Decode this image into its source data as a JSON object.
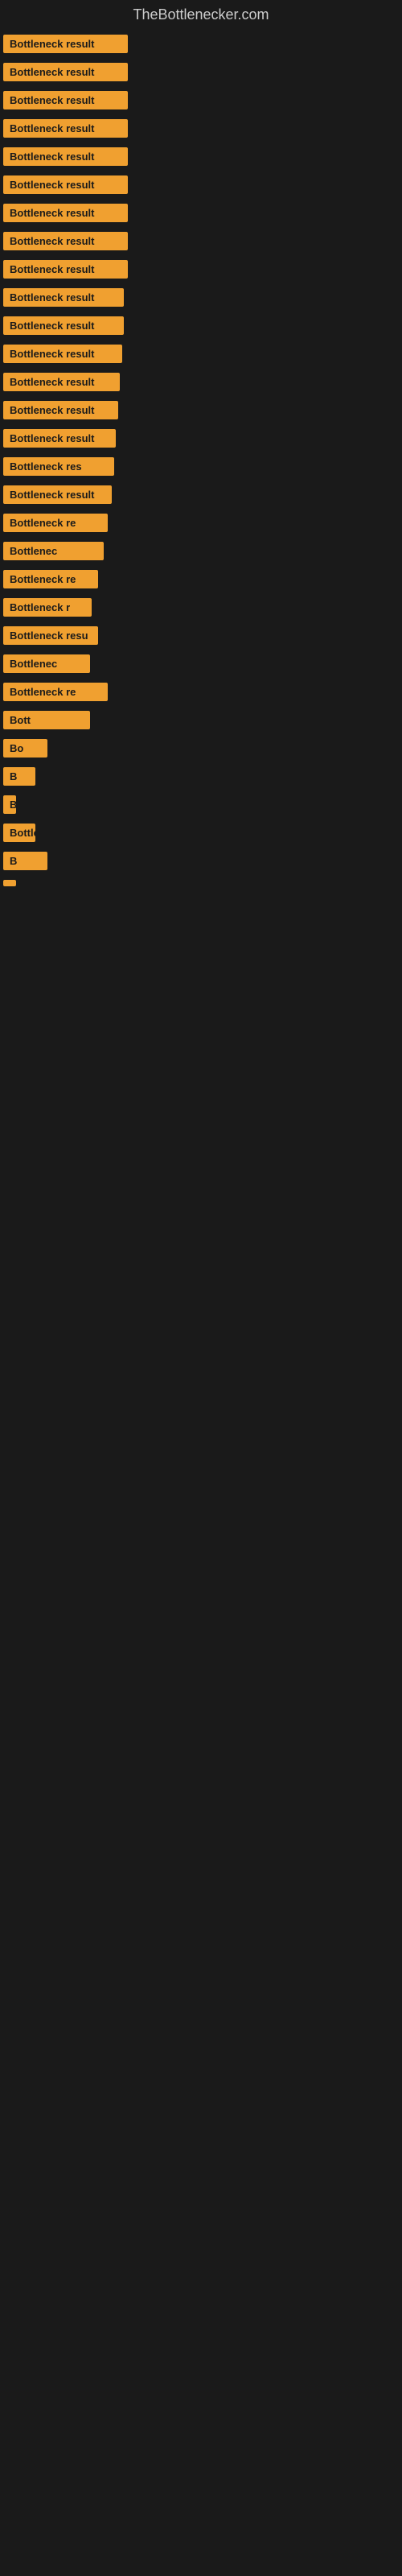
{
  "site": {
    "title": "TheBottlenecker.com"
  },
  "rows": [
    {
      "id": 1,
      "label": "Bottleneck result"
    },
    {
      "id": 2,
      "label": "Bottleneck result"
    },
    {
      "id": 3,
      "label": "Bottleneck result"
    },
    {
      "id": 4,
      "label": "Bottleneck result"
    },
    {
      "id": 5,
      "label": "Bottleneck result"
    },
    {
      "id": 6,
      "label": "Bottleneck result"
    },
    {
      "id": 7,
      "label": "Bottleneck result"
    },
    {
      "id": 8,
      "label": "Bottleneck result"
    },
    {
      "id": 9,
      "label": "Bottleneck result"
    },
    {
      "id": 10,
      "label": "Bottleneck result"
    },
    {
      "id": 11,
      "label": "Bottleneck result"
    },
    {
      "id": 12,
      "label": "Bottleneck result"
    },
    {
      "id": 13,
      "label": "Bottleneck result"
    },
    {
      "id": 14,
      "label": "Bottleneck result"
    },
    {
      "id": 15,
      "label": "Bottleneck result"
    },
    {
      "id": 16,
      "label": "Bottleneck res"
    },
    {
      "id": 17,
      "label": "Bottleneck result"
    },
    {
      "id": 18,
      "label": "Bottleneck re"
    },
    {
      "id": 19,
      "label": "Bottlenec"
    },
    {
      "id": 20,
      "label": "Bottleneck re"
    },
    {
      "id": 21,
      "label": "Bottleneck r"
    },
    {
      "id": 22,
      "label": "Bottleneck resu"
    },
    {
      "id": 23,
      "label": "Bottlenec"
    },
    {
      "id": 24,
      "label": "Bottleneck re"
    },
    {
      "id": 25,
      "label": "Bott"
    },
    {
      "id": 26,
      "label": "Bo"
    },
    {
      "id": 27,
      "label": "B"
    },
    {
      "id": 28,
      "label": "Bo"
    },
    {
      "id": 29,
      "label": "Bottle"
    },
    {
      "id": 30,
      "label": "B"
    },
    {
      "id": 31,
      "label": ""
    }
  ],
  "colors": {
    "badge_bg": "#f0a030",
    "badge_text": "#1a1a1a",
    "page_bg": "#1a1a1a",
    "title_color": "#cccccc"
  }
}
